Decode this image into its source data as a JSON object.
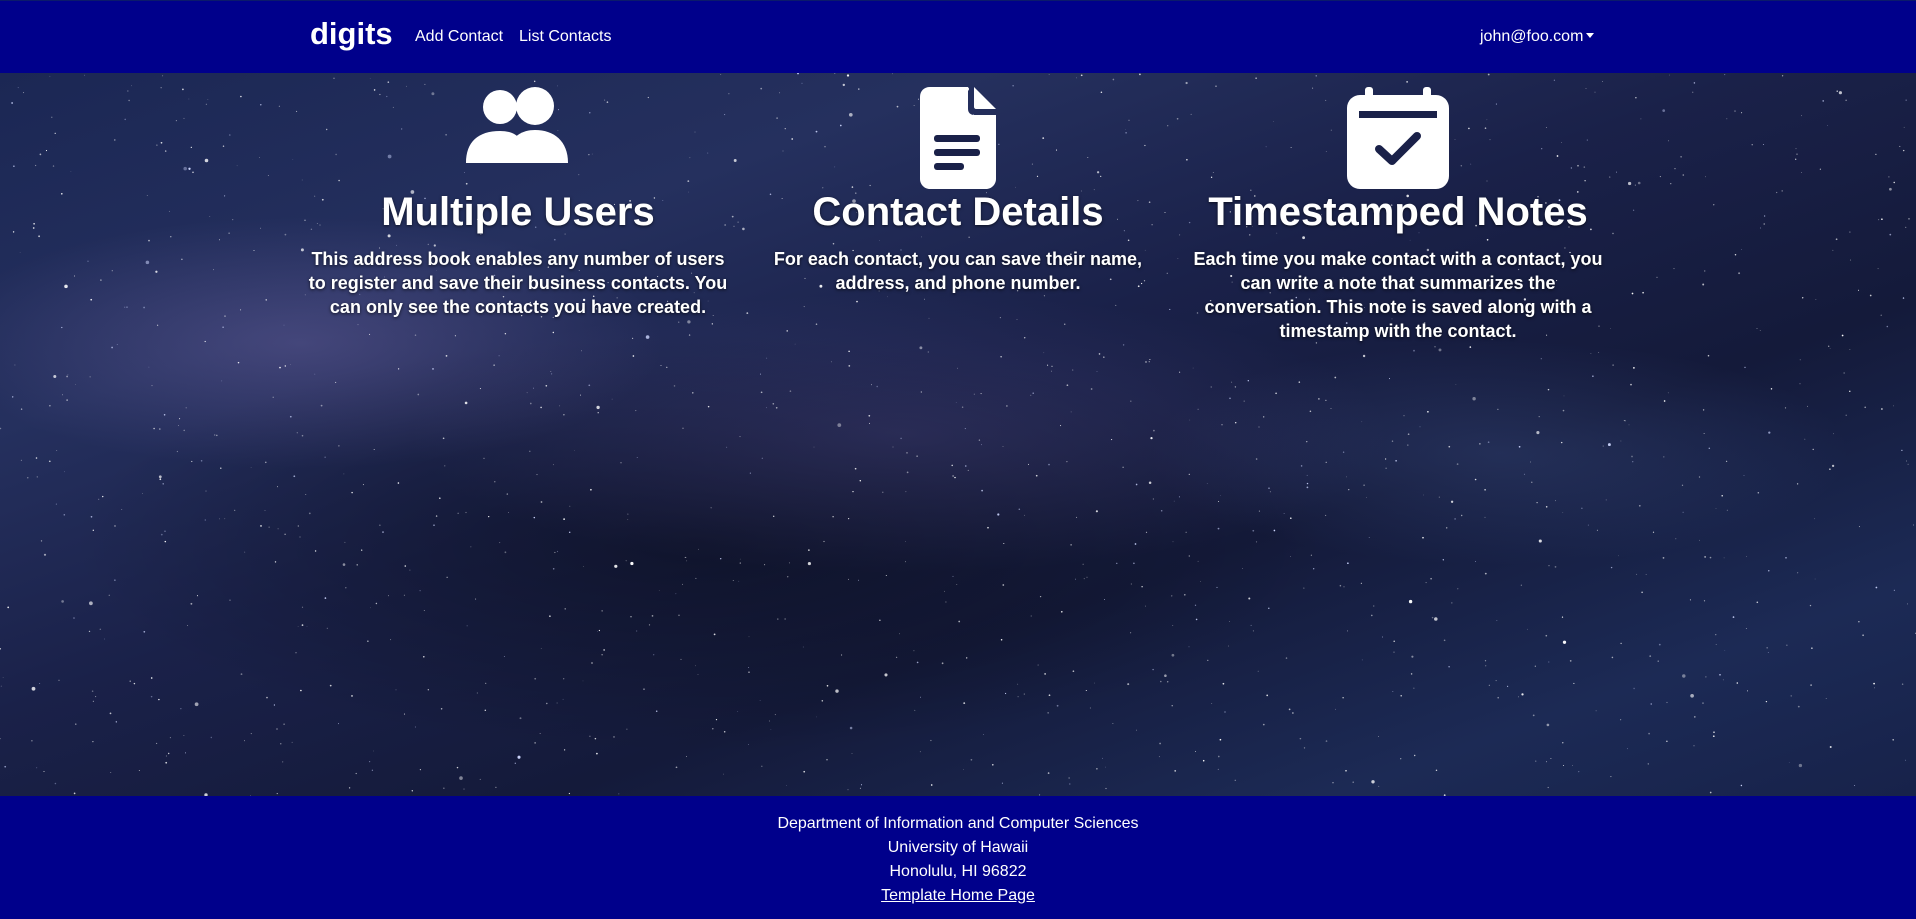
{
  "navbar": {
    "brand": "digits",
    "links": [
      {
        "label": "Add Contact"
      },
      {
        "label": "List Contacts"
      }
    ],
    "user_menu": "john@foo.com"
  },
  "features": [
    {
      "icon": "users-icon",
      "title": "Multiple Users",
      "text": "This address book enables any number of users to register and save their business contacts. You can only see the contacts you have created."
    },
    {
      "icon": "file-text-icon",
      "title": "Contact Details",
      "text": "For each contact, you can save their name, address, and phone number."
    },
    {
      "icon": "calendar-check-icon",
      "title": "Timestamped Notes",
      "text": "Each time you make contact with a contact, you can write a note that summarizes the conversation. This note is saved along with a timestamp with the contact."
    }
  ],
  "footer": {
    "line1": "Department of Information and Computer Sciences",
    "line2": "University of Hawaii",
    "line3": "Honolulu, HI 96822",
    "link": "Template Home Page"
  },
  "colors": {
    "navbar": "#00008B",
    "footer": "#00008B",
    "text": "#FFFFFF"
  }
}
